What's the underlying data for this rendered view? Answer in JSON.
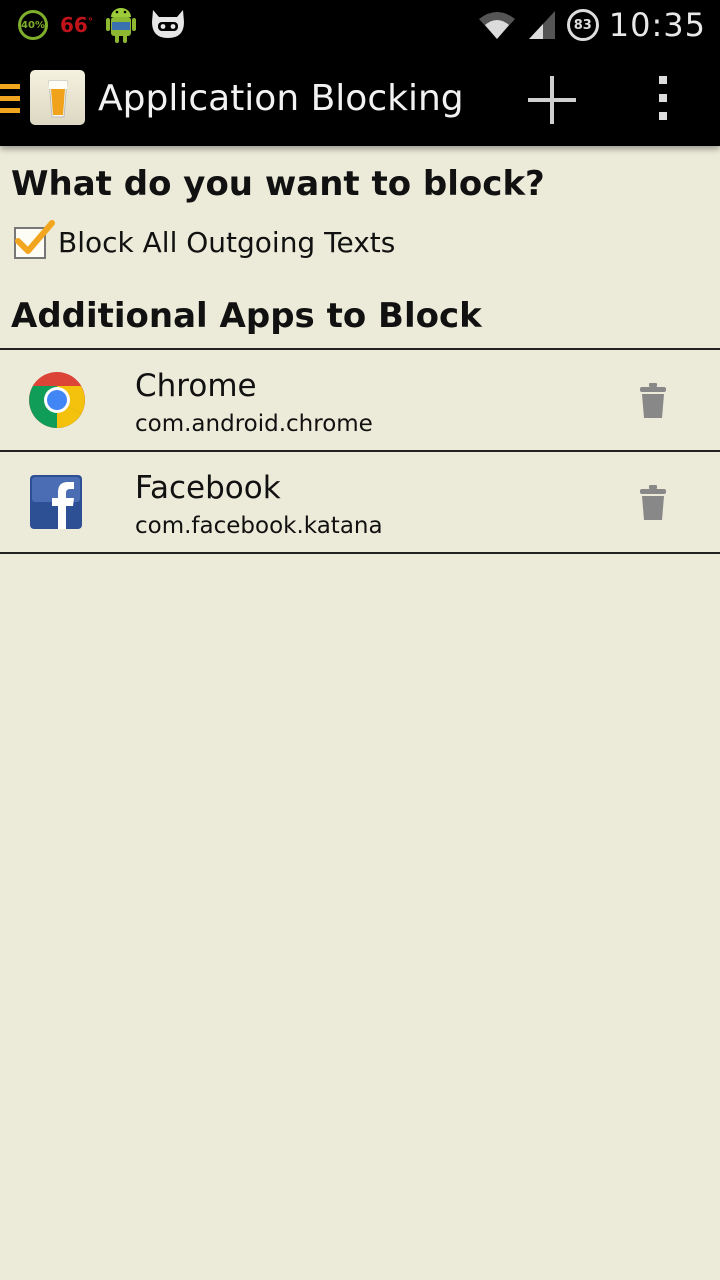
{
  "status_bar": {
    "battery_percent": "40%",
    "temperature": "66",
    "temperature_unit": "°",
    "badge_number": "83",
    "time": "10:35",
    "icons": [
      "battery-ring-icon",
      "android-icon",
      "cyanogen-icon",
      "wifi-icon",
      "signal-icon"
    ]
  },
  "action_bar": {
    "title": "Application Blocking",
    "icons": [
      "drawer-icon",
      "beer-glass-icon",
      "add-icon",
      "overflow-menu-icon"
    ]
  },
  "content": {
    "block_heading": "What do you want to block?",
    "block_all_texts": {
      "label": "Block All Outgoing Texts",
      "checked": true
    },
    "apps_heading": "Additional Apps to Block",
    "apps": [
      {
        "name": "Chrome",
        "package": "com.android.chrome",
        "icon": "chrome-icon"
      },
      {
        "name": "Facebook",
        "package": "com.facebook.katana",
        "icon": "facebook-icon"
      }
    ]
  },
  "colors": {
    "background": "#ecebd9",
    "action_bar": "#000000",
    "drawer_accent": "#f2a51f",
    "checkmark": "#f2a51f",
    "battery_green": "#7fae2c",
    "temperature_red": "#c0141a"
  }
}
